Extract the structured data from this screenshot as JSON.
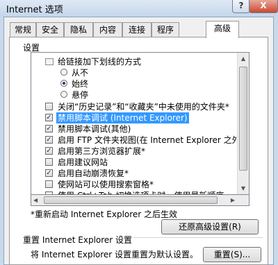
{
  "window": {
    "title": "Internet 选项",
    "help_label": "?",
    "close_label": "X"
  },
  "tabs": [
    {
      "label": "常规"
    },
    {
      "label": "安全"
    },
    {
      "label": "隐私"
    },
    {
      "label": "内容"
    },
    {
      "label": "连接"
    },
    {
      "label": "程序"
    },
    {
      "label": "高级",
      "active": true
    }
  ],
  "settings": {
    "group_label": "设置",
    "items": [
      {
        "type": "group",
        "label": "给链接加下划线的方式"
      },
      {
        "type": "radio",
        "label": "从不",
        "checked": false
      },
      {
        "type": "radio",
        "label": "始终",
        "checked": true
      },
      {
        "type": "radio",
        "label": "悬停",
        "checked": false
      },
      {
        "type": "checkbox",
        "label": "关闭“历史记录”和“收藏夹”中未使用的文件夹*",
        "checked": false
      },
      {
        "type": "checkbox",
        "label": "禁用脚本调试 (Internet Explorer)",
        "checked": true,
        "selected": true
      },
      {
        "type": "checkbox",
        "label": "禁用脚本调试(其他)",
        "checked": true
      },
      {
        "type": "checkbox",
        "label": "启用 FTP 文件夹视图(在 Internet Explorer 之外)",
        "checked": true
      },
      {
        "type": "checkbox",
        "label": "启用第三方浏览器扩展*",
        "checked": true
      },
      {
        "type": "checkbox",
        "label": "启用建议网站",
        "checked": false
      },
      {
        "type": "checkbox",
        "label": "启用自动崩溃恢复*",
        "checked": true
      },
      {
        "type": "checkbox",
        "label": "使网站可以使用搜索窗格*",
        "checked": false
      },
      {
        "type": "checkbox",
        "label": "使用 Ctrl+Tab 切换选项卡时，使用最新顺序",
        "checked": false
      }
    ],
    "restart_note": "*重新启动 Internet Explorer 之后生效",
    "restore_button": "还原高级设置(R)"
  },
  "reset": {
    "title": "重置 Internet Explorer 设置",
    "description": "将 Internet Explorer 设置重置为默认设置。",
    "button": "重置(S)..."
  }
}
